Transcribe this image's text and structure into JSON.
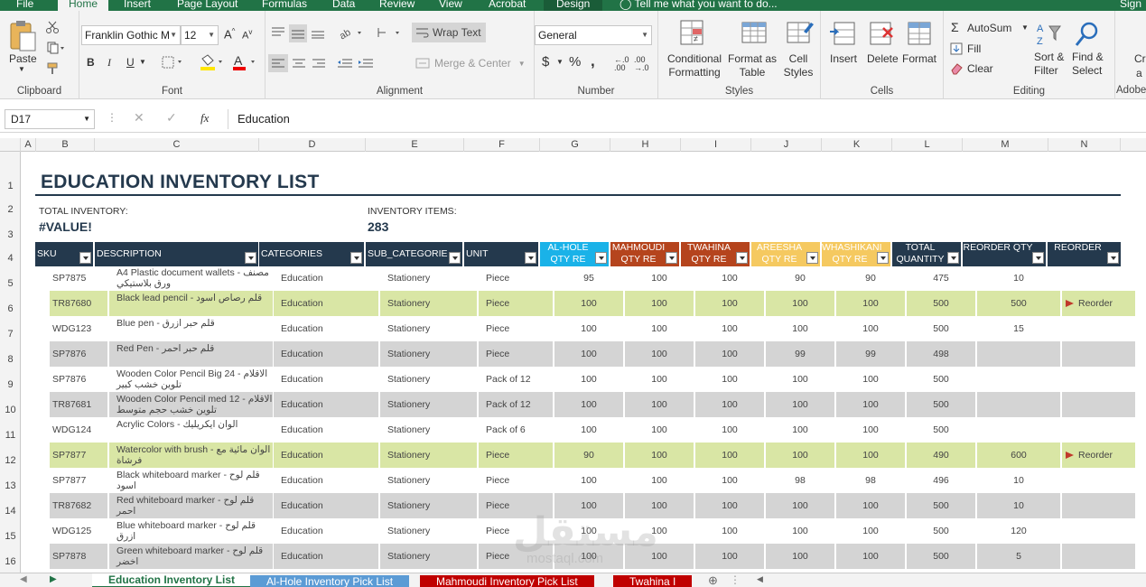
{
  "ribbon_tabs": [
    "File",
    "Home",
    "Insert",
    "Page Layout",
    "Formulas",
    "Data",
    "Review",
    "View",
    "Acrobat",
    "Design"
  ],
  "tell_me": "Tell me what you want to do...",
  "sign_in": "Sign",
  "clipboard": {
    "paste": "Paste",
    "label": "Clipboard"
  },
  "font": {
    "family": "Franklin Gothic M",
    "size": "12",
    "bold": "B",
    "italic": "I",
    "underline": "U",
    "label": "Font"
  },
  "alignment": {
    "wrap": "Wrap Text",
    "merge": "Merge & Center",
    "label": "Alignment"
  },
  "number": {
    "format": "General",
    "currency": "$",
    "percent": "%",
    "comma": ",",
    "label": "Number"
  },
  "styles": {
    "cond": "Conditional Formatting",
    "format_table": "Format as Table",
    "cell_styles": "Cell Styles",
    "label": "Styles"
  },
  "cells": {
    "insert": "Insert",
    "delete": "Delete",
    "format": "Format",
    "label": "Cells"
  },
  "editing": {
    "autosum": "AutoSum",
    "fill": "Fill",
    "clear": "Clear",
    "sort": "Sort & Filter",
    "find": "Find & Select",
    "label": "Editing"
  },
  "adobe_label": "Adobe",
  "adobe_cr": "Cr",
  "adobe_a": "a",
  "formula_bar": {
    "name_box": "D17",
    "fx": "fx",
    "content": "Education"
  },
  "columns": [
    "A",
    "B",
    "C",
    "D",
    "E",
    "F",
    "G",
    "H",
    "I",
    "J",
    "K",
    "L",
    "M",
    "N"
  ],
  "rows": [
    "1",
    "2",
    "3",
    "4",
    "5",
    "6",
    "7",
    "8",
    "9",
    "10",
    "11",
    "12",
    "13",
    "14",
    "15",
    "16"
  ],
  "sheet": {
    "title": "EDUCATION INVENTORY LIST",
    "total_inventory_label": "TOTAL INVENTORY:",
    "total_inventory_value": "#VALUE!",
    "inventory_items_label": "INVENTORY ITEMS:",
    "inventory_items_value": "283",
    "headers": [
      {
        "text": "SKU",
        "bg": "#24394d"
      },
      {
        "text": "DESCRIPTION",
        "bg": "#24394d"
      },
      {
        "text": "CATEGORIES",
        "bg": "#24394d"
      },
      {
        "text": "SUB_CATEGORIES",
        "bg": "#24394d"
      },
      {
        "text": "UNIT",
        "bg": "#24394d"
      },
      {
        "text": "AL-HOLE QTY RE",
        "bg": "#1ab2e8"
      },
      {
        "text": "MAHMOUDI QTY RE",
        "bg": "#b5441d"
      },
      {
        "text": "TWAHINA QTY RE",
        "bg": "#b5441d"
      },
      {
        "text": "AREESHA QTY RE",
        "bg": "#f5c960"
      },
      {
        "text": "WHASHIKANI QTY RE",
        "bg": "#f5c960"
      },
      {
        "text": "TOTAL QUANTITY",
        "bg": "#24394d"
      },
      {
        "text": "REORDER QTY",
        "bg": "#24394d"
      },
      {
        "text": "REORDER",
        "bg": "#24394d"
      }
    ],
    "items": [
      {
        "sku": "SP7875",
        "desc": "A4 Plastic document wallets - مصنف ورق بلاستيكي",
        "cat": "Education",
        "sub": "Stationery",
        "unit": "Piece",
        "q1": "95",
        "q2": "100",
        "q3": "100",
        "q4": "90",
        "q5": "90",
        "total": "475",
        "rq": "10",
        "flag": "",
        "style": "plain"
      },
      {
        "sku": "TR87680",
        "desc": "Black lead pencil - قلم رصاص اسود",
        "cat": "Education",
        "sub": "Stationery",
        "unit": "Piece",
        "q1": "100",
        "q2": "100",
        "q3": "100",
        "q4": "100",
        "q5": "100",
        "total": "500",
        "rq": "500",
        "flag": "Reorder",
        "style": "green"
      },
      {
        "sku": "WDG123",
        "desc": "Blue pen - قلم حبر ازرق",
        "cat": "Education",
        "sub": "Stationery",
        "unit": "Piece",
        "q1": "100",
        "q2": "100",
        "q3": "100",
        "q4": "100",
        "q5": "100",
        "total": "500",
        "rq": "15",
        "flag": "",
        "style": "plain"
      },
      {
        "sku": "SP7876",
        "desc": "Red Pen - قلم حبر احمر",
        "cat": "Education",
        "sub": "Stationery",
        "unit": "Piece",
        "q1": "100",
        "q2": "100",
        "q3": "100",
        "q4": "99",
        "q5": "99",
        "total": "498",
        "rq": "",
        "flag": "",
        "style": "gray"
      },
      {
        "sku": "SP7876",
        "desc": "Wooden Color Pencil Big 24 - الاقلام تلوين خشب كبير",
        "cat": "Education",
        "sub": "Stationery",
        "unit": "Pack of 12",
        "q1": "100",
        "q2": "100",
        "q3": "100",
        "q4": "100",
        "q5": "100",
        "total": "500",
        "rq": "",
        "flag": "",
        "style": "plain"
      },
      {
        "sku": "TR87681",
        "desc": "Wooden Color Pencil med 12 - الاقلام تلوين خشب حجم متوسط",
        "cat": "Education",
        "sub": "Stationery",
        "unit": "Pack of 12",
        "q1": "100",
        "q2": "100",
        "q3": "100",
        "q4": "100",
        "q5": "100",
        "total": "500",
        "rq": "",
        "flag": "",
        "style": "gray"
      },
      {
        "sku": "WDG124",
        "desc": "Acrylic Colors - الوان ايكريليك",
        "cat": "Education",
        "sub": "Stationery",
        "unit": "Pack of 6",
        "q1": "100",
        "q2": "100",
        "q3": "100",
        "q4": "100",
        "q5": "100",
        "total": "500",
        "rq": "",
        "flag": "",
        "style": "plain"
      },
      {
        "sku": "SP7877",
        "desc": "Watercolor with brush - الوان مائية مع فرشاة",
        "cat": "Education",
        "sub": "Stationery",
        "unit": "Piece",
        "q1": "90",
        "q2": "100",
        "q3": "100",
        "q4": "100",
        "q5": "100",
        "total": "490",
        "rq": "600",
        "flag": "Reorder",
        "style": "green"
      },
      {
        "sku": "SP7877",
        "desc": "Black whiteboard marker - قلم لوح اسود",
        "cat": "Education",
        "sub": "Stationery",
        "unit": "Piece",
        "q1": "100",
        "q2": "100",
        "q3": "100",
        "q4": "98",
        "q5": "98",
        "total": "496",
        "rq": "10",
        "flag": "",
        "style": "plain"
      },
      {
        "sku": "TR87682",
        "desc": "Red whiteboard marker - قلم لوح احمر",
        "cat": "Education",
        "sub": "Stationery",
        "unit": "Piece",
        "q1": "100",
        "q2": "100",
        "q3": "100",
        "q4": "100",
        "q5": "100",
        "total": "500",
        "rq": "10",
        "flag": "",
        "style": "gray"
      },
      {
        "sku": "WDG125",
        "desc": "Blue whiteboard marker - قلم لوح ازرق",
        "cat": "Education",
        "sub": "Stationery",
        "unit": "Piece",
        "q1": "100",
        "q2": "100",
        "q3": "100",
        "q4": "100",
        "q5": "100",
        "total": "500",
        "rq": "120",
        "flag": "",
        "style": "plain"
      },
      {
        "sku": "SP7878",
        "desc": "Green whiteboard marker - قلم لوح اخضر",
        "cat": "Education",
        "sub": "Stationery",
        "unit": "Piece",
        "q1": "100",
        "q2": "100",
        "q3": "100",
        "q4": "100",
        "q5": "100",
        "total": "500",
        "rq": "5",
        "flag": "",
        "style": "gray"
      }
    ]
  },
  "sheet_tabs": [
    {
      "label": "Education Inventory List",
      "bg": "#ffffff",
      "fg": "#217346"
    },
    {
      "label": "Al-Hole Inventory Pick List",
      "bg": "#5b9bd5",
      "fg": "#ffffff"
    },
    {
      "label": "Mahmoudi Inventory Pick List",
      "bg": "#c00000",
      "fg": "#ffffff"
    },
    {
      "label": "Twahina I",
      "bg": "#c00000",
      "fg": "#ffffff"
    }
  ],
  "watermark": "مستقل",
  "watermark_sub": "mostaql.com",
  "colors": {
    "excel_green": "#217346",
    "header_navy": "#24394d",
    "row_green": "#d9e6a5",
    "row_gray": "#d4d4d4"
  }
}
